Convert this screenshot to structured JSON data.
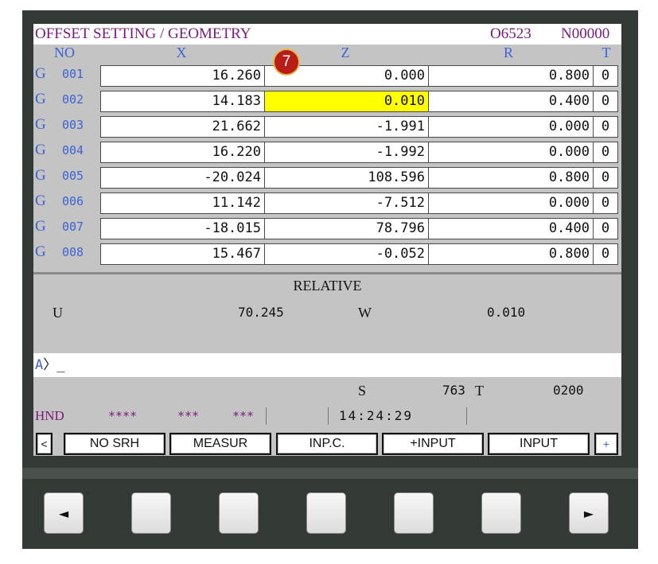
{
  "title_bar": {
    "title": "OFFSET SETTING / GEOMETRY",
    "program": "O6523",
    "sequence": "N00000"
  },
  "columns": {
    "no": "NO",
    "x": "X",
    "z": "Z",
    "r": "R",
    "t": "T"
  },
  "rows": [
    {
      "g": "G",
      "no": "001",
      "x": "16.260",
      "z": "0.000",
      "r": "0.800",
      "t": "0"
    },
    {
      "g": "G",
      "no": "002",
      "x": "14.183",
      "z": "0.010",
      "r": "0.400",
      "t": "0"
    },
    {
      "g": "G",
      "no": "003",
      "x": "21.662",
      "z": "-1.991",
      "r": "0.000",
      "t": "0"
    },
    {
      "g": "G",
      "no": "004",
      "x": "16.220",
      "z": "-1.992",
      "r": "0.000",
      "t": "0"
    },
    {
      "g": "G",
      "no": "005",
      "x": "-20.024",
      "z": "108.596",
      "r": "0.800",
      "t": "0"
    },
    {
      "g": "G",
      "no": "006",
      "x": "11.142",
      "z": "-7.512",
      "r": "0.000",
      "t": "0"
    },
    {
      "g": "G",
      "no": "007",
      "x": "-18.015",
      "z": "78.796",
      "r": "0.400",
      "t": "0"
    },
    {
      "g": "G",
      "no": "008",
      "x": "15.467",
      "z": "-0.052",
      "r": "0.800",
      "t": "0"
    }
  ],
  "badge": "7",
  "relative": {
    "title": "RELATIVE",
    "u_label": "U",
    "u_value": "70.245",
    "w_label": "W",
    "w_value": "0.010"
  },
  "input_line": {
    "prompt": "A",
    "cursor": "〉_"
  },
  "spindle": {
    "s_label": "S",
    "s_value": "763",
    "t_label": "T",
    "t_value": "0200"
  },
  "status": {
    "mode": "HND",
    "stars1": "****",
    "stars2": "***",
    "stars3": "***",
    "time": "14:24:29"
  },
  "softkeys": {
    "prev": "<",
    "no_srh": "NO SRH",
    "measur": "MEASUR",
    "inp_c": "INP.C.",
    "plus_input": "+INPUT",
    "input": "INPUT",
    "next": "+"
  },
  "hw_keys": {
    "left": "◄",
    "right": "►"
  },
  "colors": {
    "title_purple": "#7a1a7a",
    "label_blue": "#3c64d4",
    "highlight_yellow": "#ffff00",
    "badge_red": "#b81e17",
    "bezel": "#333a36"
  }
}
